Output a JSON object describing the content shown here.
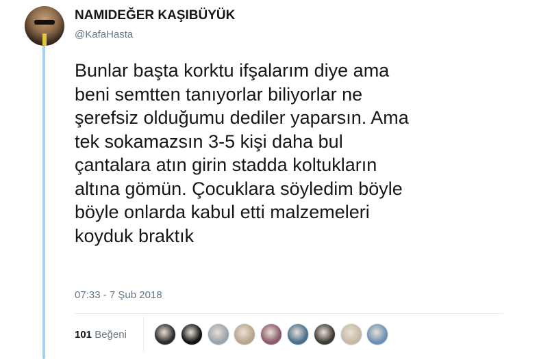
{
  "author": {
    "name": "NAMIDEĞER KAŞIBÜYÜK",
    "handle": "@KafaHasta"
  },
  "tweet": {
    "lines": [
      "Bunlar başta korktu ifşalarım diye ama",
      "beni semtten tanıyorlar biliyorlar ne",
      "şerefsiz olduğumu dediler yaparsın. Ama",
      "tek sokamazsın 3-5 kişi daha bul",
      "çantalara atın girin stadda koltukların",
      "altına gömün. Çocuklara söyledim böyle",
      "böyle onlarda kabul etti malzemeleri",
      "koyduk braktık"
    ],
    "timestamp": "07:33 - 7 Şub 2018"
  },
  "stats": {
    "likes_count": "101",
    "likes_label": "Beğeni"
  },
  "likers": [
    {
      "color": "#2b2b2b"
    },
    {
      "color": "#111111"
    },
    {
      "color": "#9aa3ab"
    },
    {
      "color": "#b7a58a"
    },
    {
      "color": "#8a5a6a"
    },
    {
      "color": "#4a6f8a"
    },
    {
      "color": "#3e3a36"
    },
    {
      "color": "#c7b8a4"
    },
    {
      "color": "#6d8fb3"
    }
  ],
  "colors": {
    "thread_line": "#a3d2f0",
    "text": "#14171a",
    "secondary_text": "#657786"
  }
}
